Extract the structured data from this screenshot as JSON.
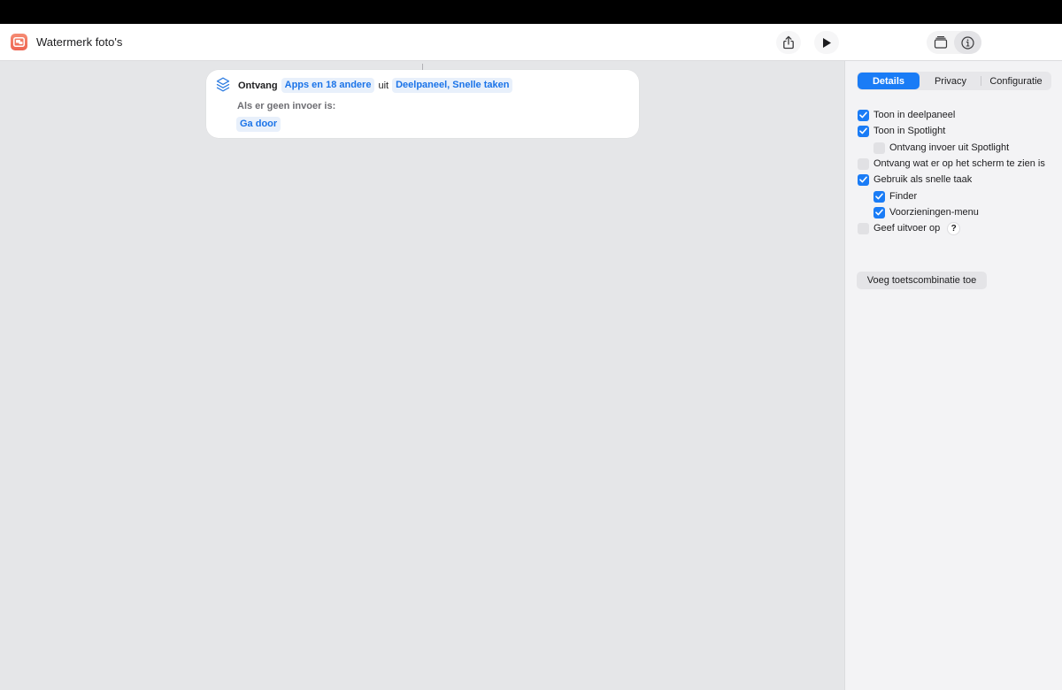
{
  "window": {
    "title": "Watermerk foto's"
  },
  "toolbar": {
    "share_icon": "share-icon",
    "run_icon": "play-icon",
    "library_icon": "library-icon",
    "info_icon": "info-icon"
  },
  "action": {
    "icon": "layers-icon",
    "verb": "Ontvang",
    "input_token": "Apps en 18 andere",
    "connector_word": "uit",
    "source_token": "Deelpaneel, Snelle taken",
    "no_input_label": "Als er geen invoer is:",
    "no_input_token": "Ga door"
  },
  "sidebar": {
    "tabs": [
      {
        "label": "Details",
        "selected": true
      },
      {
        "label": "Privacy",
        "selected": false
      },
      {
        "label": "Configuratie",
        "selected": false
      }
    ],
    "options": [
      {
        "label": "Toon in deelpaneel",
        "checked": true,
        "indent": 0
      },
      {
        "label": "Toon in Spotlight",
        "checked": true,
        "indent": 0
      },
      {
        "label": "Ontvang invoer uit Spotlight",
        "checked": false,
        "indent": 1
      },
      {
        "label": "Ontvang wat er op het scherm te zien is",
        "checked": false,
        "indent": 0
      },
      {
        "label": "Gebruik als snelle taak",
        "checked": true,
        "indent": 0
      },
      {
        "label": "Finder",
        "checked": true,
        "indent": 1
      },
      {
        "label": "Voorzieningen-menu",
        "checked": true,
        "indent": 1
      },
      {
        "label": "Geef uitvoer op",
        "checked": false,
        "indent": 0
      }
    ],
    "help_label": "?",
    "shortcut_button": "Voeg toetscombinatie toe"
  },
  "colors": {
    "accent": "#1a7cf6",
    "token_text": "#1a73e8",
    "token_bg": "#e8f0fb",
    "canvas": "#e5e6e8",
    "app_icon": "#ee6451"
  }
}
